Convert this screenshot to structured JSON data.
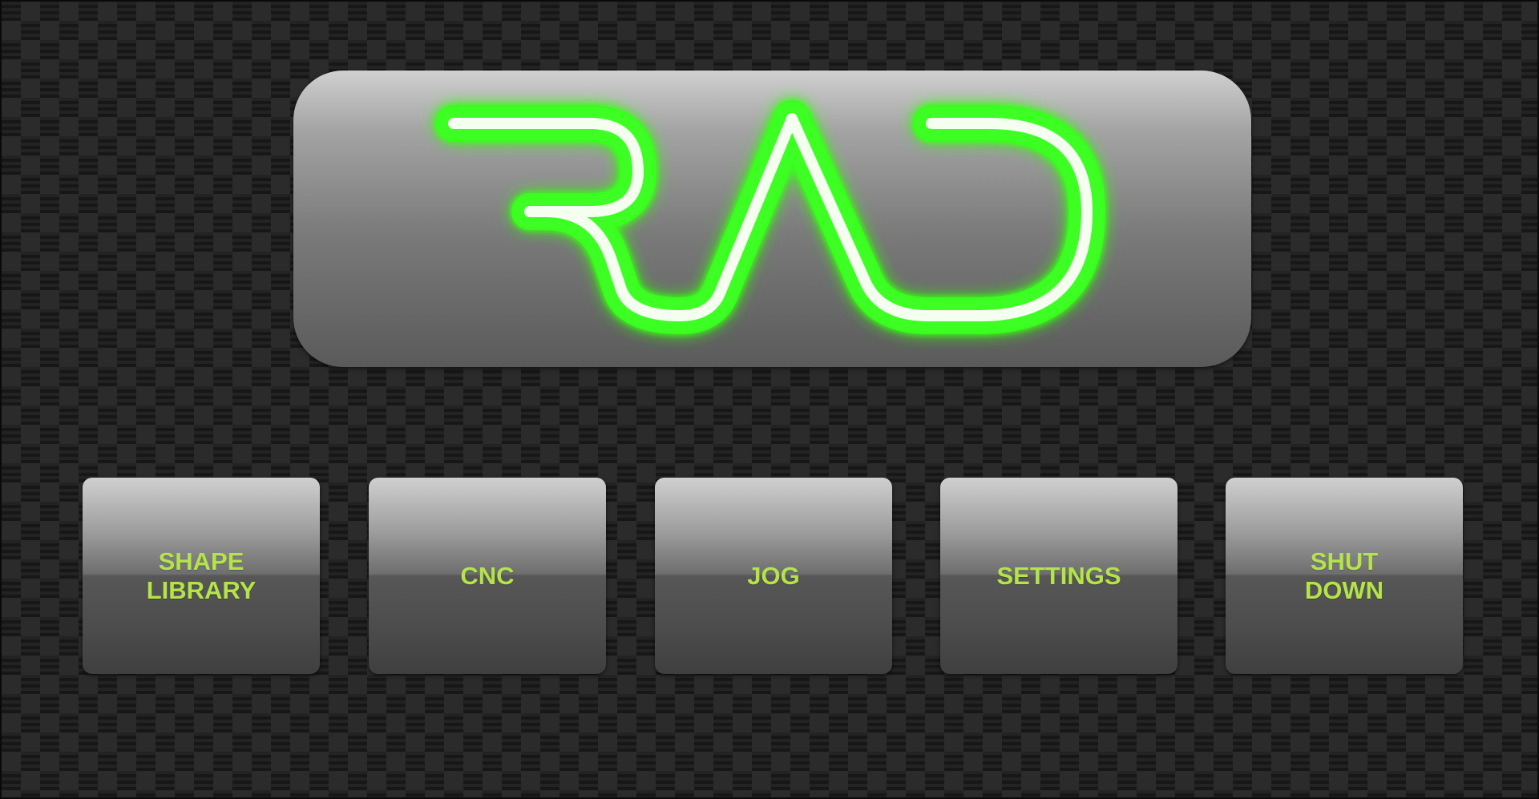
{
  "app": {
    "logo_text": "RAD",
    "logo_color": "#39ff1a"
  },
  "buttons": [
    {
      "label": "SHAPE\nLIBRARY"
    },
    {
      "label": "CNC"
    },
    {
      "label": "JOG"
    },
    {
      "label": "SETTINGS"
    },
    {
      "label": "SHUT\nDOWN"
    }
  ],
  "colors": {
    "label_text": "#b4e34a",
    "background": "#1f1f1f"
  }
}
